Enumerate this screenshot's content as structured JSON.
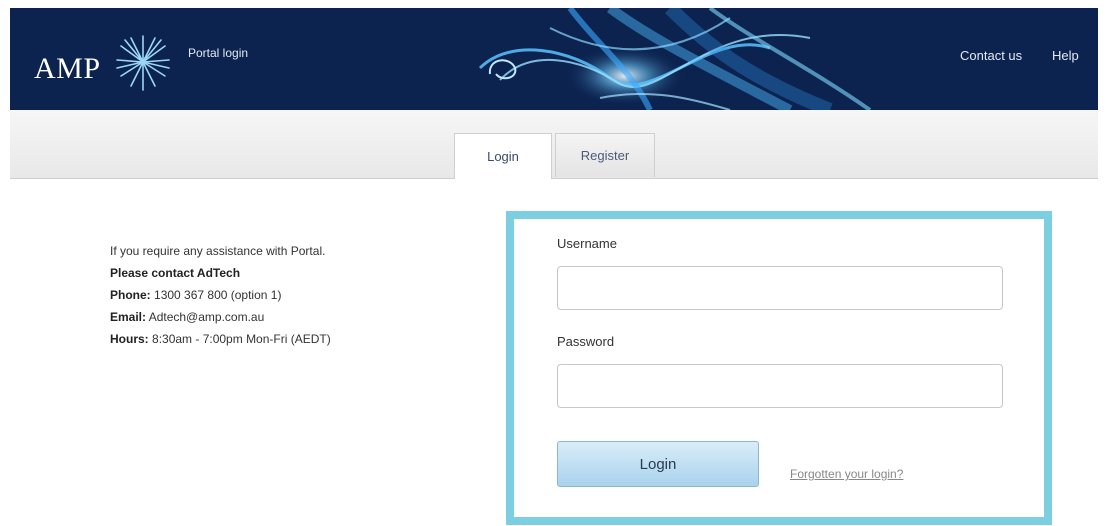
{
  "header": {
    "logo_text": "AMP",
    "portal_title": "Portal login",
    "nav": {
      "contact": "Contact us",
      "help": "Help"
    }
  },
  "tabs": {
    "login": "Login",
    "register": "Register"
  },
  "info": {
    "assistance": "If you require any assistance with Portal.",
    "contact_heading": "Please contact AdTech",
    "phone_label": "Phone:",
    "phone_value": "1300 367 800 (option 1)",
    "email_label": "Email:",
    "email_value": "Adtech@amp.com.au",
    "hours_label": "Hours:",
    "hours_value": "8:30am - 7:00pm Mon-Fri (AEDT)"
  },
  "form": {
    "username_label": "Username",
    "username_value": "",
    "password_label": "Password",
    "password_value": "",
    "login_button": "Login",
    "forgot_link": "Forgotten your login?"
  },
  "colors": {
    "header_bg": "#0c2350",
    "highlight_border": "#7ccfe0",
    "button_bg": "#a9d2ec"
  }
}
